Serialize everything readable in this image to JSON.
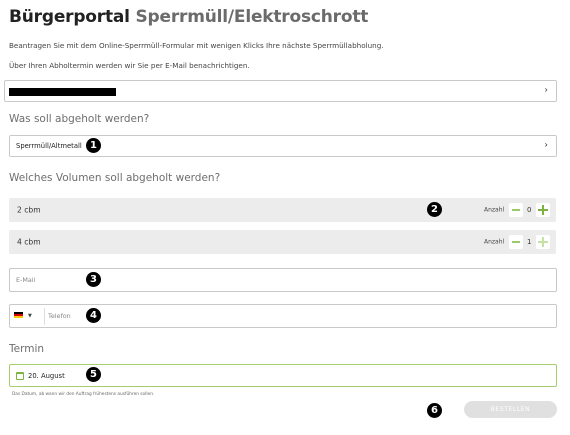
{
  "header": {
    "title_main": "Bürgerportal",
    "title_sub": "Sperrmüll/Elektroschrott"
  },
  "intro": {
    "line1": "Beantragen Sie mit dem Online-Sperrmüll-Formular mit wenigen Klicks Ihre nächste Sperrmüllabholung.",
    "line2": "Über Ihren Abholtermin werden wir Sie per E-Mail benachrichtigen."
  },
  "address_select": {
    "value_redacted": true
  },
  "pickup_question": "Was soll abgeholt werden?",
  "pickup_select": {
    "value": "Sperrmüll/Altmetall"
  },
  "volume_question": "Welches Volumen soll abgeholt werden?",
  "volumes": [
    {
      "label": "2 cbm",
      "count_label": "Anzahl",
      "count": "0"
    },
    {
      "label": "4 cbm",
      "count_label": "Anzahl",
      "count": "1"
    }
  ],
  "email": {
    "placeholder": "E-Mail"
  },
  "phone": {
    "placeholder": "Telefon",
    "country": "DE"
  },
  "termin": {
    "label": "Termin",
    "value": "20. August",
    "hint": "Das Datum, ab wann wir den Auftrag frühestens ausführen sollen."
  },
  "order_button": {
    "label": "BESTELLEN"
  },
  "badges": [
    "1",
    "2",
    "3",
    "4",
    "5",
    "6"
  ],
  "colors": {
    "accent": "#7cb342",
    "button_disabled": "#e0e0e0"
  },
  "icons": {
    "chevron": "chevron-right-icon",
    "calendar": "calendar-icon",
    "flag": "germany-flag-icon"
  }
}
